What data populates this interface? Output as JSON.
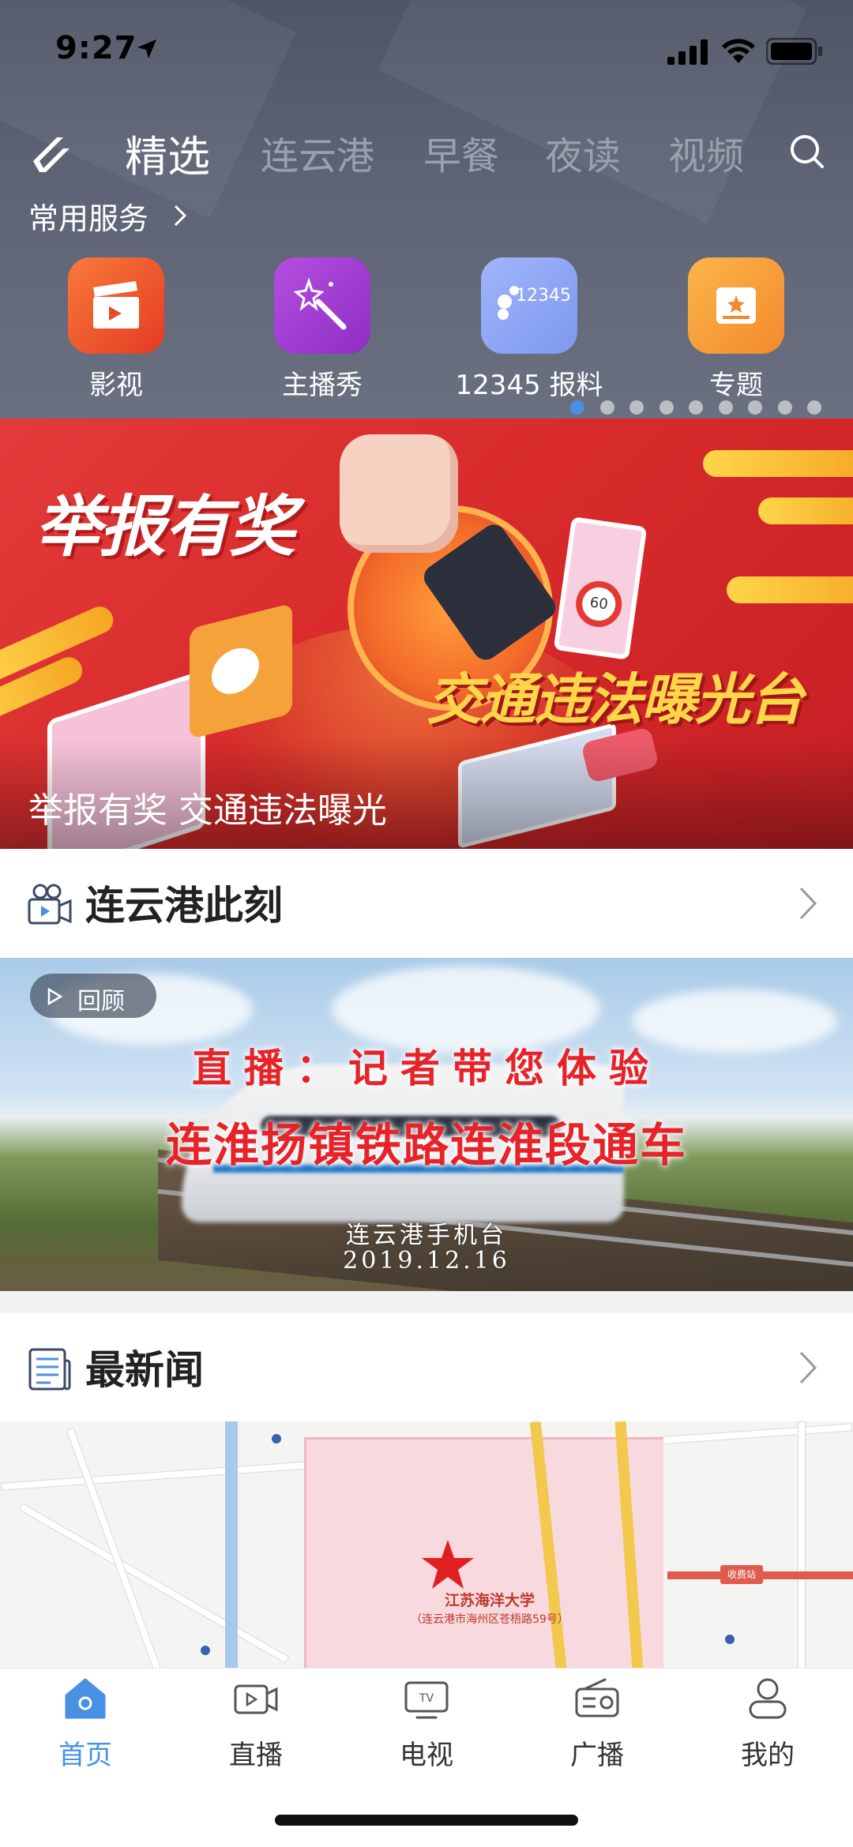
{
  "status_bar": {
    "time": "9:27"
  },
  "top_nav": {
    "tabs": [
      {
        "label": "精选",
        "active": true
      },
      {
        "label": "连云港",
        "active": false
      },
      {
        "label": "早餐",
        "active": false
      },
      {
        "label": "夜读",
        "active": false
      },
      {
        "label": "视频",
        "active": false
      }
    ]
  },
  "services": {
    "title": "常用服务",
    "items": [
      {
        "label": "影视",
        "icon": "clapperboard-icon",
        "color": "#f0542b"
      },
      {
        "label": "主播秀",
        "icon": "magic-wand-icon",
        "color": "#a13fd0"
      },
      {
        "label": "12345 报料",
        "icon": "12345-hotline-icon",
        "tile_text": "12345",
        "color": "#8fa8f5"
      },
      {
        "label": "专题",
        "icon": "star-badge-icon",
        "color": "#f7a13a"
      }
    ]
  },
  "banner": {
    "headline_1": "举报有奖",
    "headline_2": "交通违法曝光台",
    "sign_speed": "60",
    "caption": "举报有奖 交通违法曝光",
    "page_count": 9,
    "active_page": 1
  },
  "section_live": {
    "title": "连云港此刻",
    "replay_label": "回顾",
    "overlay_line1": "直播：记者带您体验",
    "overlay_line2": "连淮扬镇铁路连淮段通车",
    "overlay_line3": "连云港手机台",
    "overlay_line4": "2019.12.16"
  },
  "section_news": {
    "title": "最新闻",
    "map": {
      "campus_name": "江苏海洋大学",
      "campus_address": "（连云港市海州区苍梧路59号）",
      "station_label": "收费站"
    }
  },
  "tab_bar": {
    "items": [
      {
        "label": "首页",
        "active": true
      },
      {
        "label": "直播",
        "active": false
      },
      {
        "label": "电视",
        "active": false
      },
      {
        "label": "广播",
        "active": false
      },
      {
        "label": "我的",
        "active": false
      }
    ]
  },
  "colors": {
    "accent": "#4a90e2",
    "header_bg": "#5d6374",
    "banner_red": "#d92b2b",
    "live_title_red": "#e7232a"
  }
}
